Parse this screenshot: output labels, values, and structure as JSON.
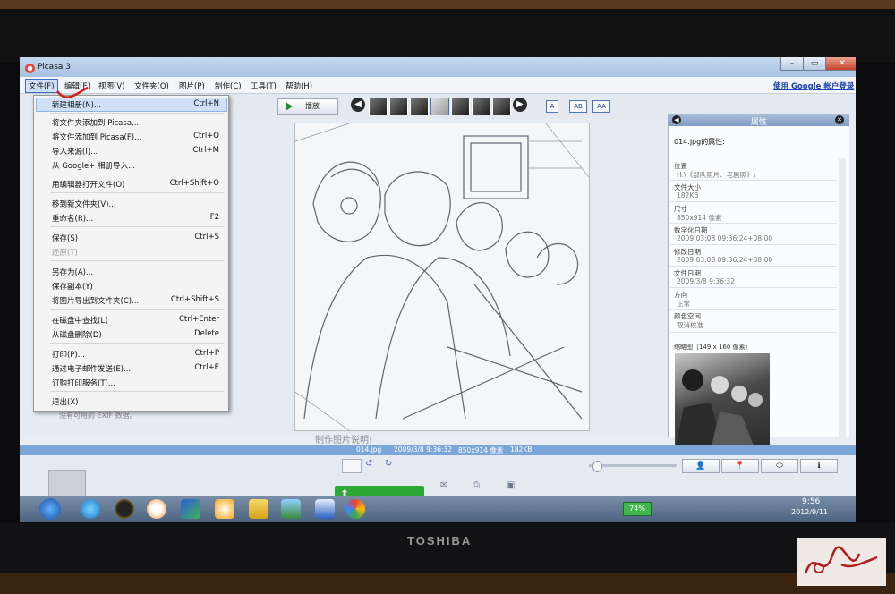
{
  "window": {
    "title": "Picasa 3",
    "controls": {
      "minimize": "–",
      "maximize": "▭",
      "close": "✕"
    }
  },
  "menubar": {
    "items": [
      "文件(F)",
      "编辑(E)",
      "视图(V)",
      "文件夹(O)",
      "图片(P)",
      "制作(C)",
      "工具(T)",
      "帮助(H)"
    ],
    "account_link": "使用 Google 帐户登录"
  },
  "file_menu": {
    "items": [
      {
        "label": "新建相册(N)...",
        "shortcut": "Ctrl+N",
        "disabled": false
      },
      {
        "label": "将文件夹添加到 Picasa...",
        "shortcut": "",
        "disabled": false
      },
      {
        "label": "将文件添加到 Picasa(F)...",
        "shortcut": "Ctrl+O",
        "disabled": false
      },
      {
        "label": "导入来源(I)...",
        "shortcut": "Ctrl+M",
        "disabled": false
      },
      {
        "label": "从 Google+ 相册导入...",
        "shortcut": "",
        "disabled": false
      },
      {
        "label": "用编辑器打开文件(O)",
        "shortcut": "Ctrl+Shift+O",
        "disabled": false
      },
      {
        "label": "移到新文件夹(V)...",
        "shortcut": "",
        "disabled": false
      },
      {
        "label": "重命名(R)...",
        "shortcut": "F2",
        "disabled": false
      },
      {
        "label": "保存(S)",
        "shortcut": "Ctrl+S",
        "disabled": false
      },
      {
        "label": "还原(T)",
        "shortcut": "",
        "disabled": true
      },
      {
        "label": "另存为(A)...",
        "shortcut": "",
        "disabled": false
      },
      {
        "label": "保存副本(Y)",
        "shortcut": "",
        "disabled": false
      },
      {
        "label": "将图片导出到文件夹(C)...",
        "shortcut": "Ctrl+Shift+S",
        "disabled": false
      },
      {
        "label": "在磁盘中查找(L)",
        "shortcut": "Ctrl+Enter",
        "disabled": false
      },
      {
        "label": "从磁盘删除(D)",
        "shortcut": "Delete",
        "disabled": false
      },
      {
        "label": "打印(P)...",
        "shortcut": "Ctrl+P",
        "disabled": false
      },
      {
        "label": "通过电子邮件发送(E)...",
        "shortcut": "Ctrl+E",
        "disabled": false
      },
      {
        "label": "订购打印服务(T)...",
        "shortcut": "",
        "disabled": false
      },
      {
        "label": "退出(X)",
        "shortcut": "",
        "disabled": false
      }
    ]
  },
  "toolbar": {
    "play_label": "播放",
    "text_buttons": [
      "A",
      "AB",
      "AA"
    ]
  },
  "viewer": {
    "caption_placeholder": "制作图片说明!"
  },
  "properties": {
    "title": "属性",
    "file_heading": "014.jpg的属性:",
    "fields": [
      {
        "label": "位置",
        "value": "H:\\《部队照片、老剧照》\\"
      },
      {
        "label": "文件大小",
        "value": "182KB"
      },
      {
        "label": "尺寸",
        "value": "850x914 像素"
      },
      {
        "label": "数字化日期",
        "value": "2009:03:08 09:36:24+08:00"
      },
      {
        "label": "修改日期",
        "value": "2009:03:08 09:36:24+08:00"
      },
      {
        "label": "文件日期",
        "value": "2009/3/8 9:36:32"
      },
      {
        "label": "方向",
        "value": "正常"
      },
      {
        "label": "颜色空间",
        "value": "取消校准"
      }
    ],
    "thumbnail_label": "缩略图（149 x 160 像素）"
  },
  "info_strip": {
    "filename": "014.jpg",
    "date": "2009/3/8 9:36:32",
    "dimensions": "850x914 像素",
    "size": "182KB"
  },
  "sidebar": {
    "exif_note": "没有可用的 EXIF 数据。"
  },
  "taskbar": {
    "battery": "74%",
    "time": "9:56",
    "date": "2012/9/11"
  },
  "monitor": {
    "brand": "TOSHIBA"
  }
}
